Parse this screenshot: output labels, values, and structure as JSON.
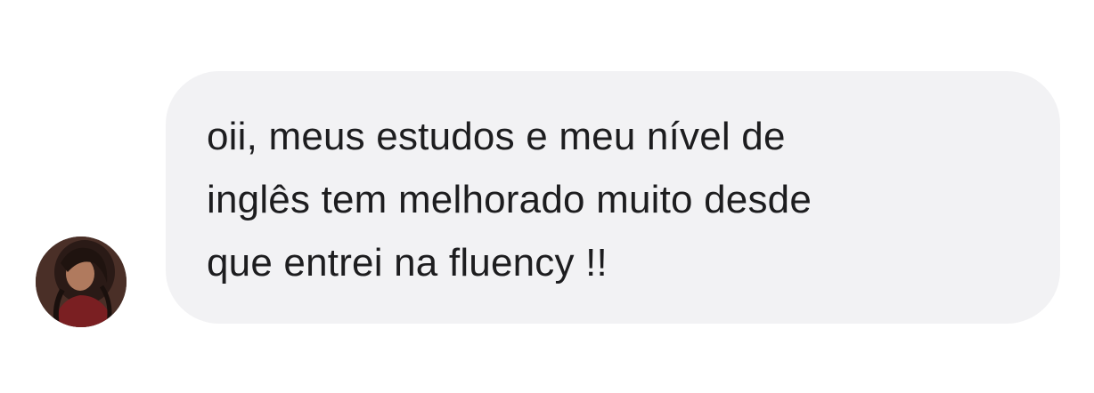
{
  "conversation": {
    "message": {
      "lines": [
        "oii, meus estudos e meu nível de",
        "inglês tem melhorado muito desde",
        "que entrei na fluency !!"
      ],
      "bubble_color": "#f2f2f4",
      "text_color": "#1d1d1f"
    },
    "sender": {
      "avatar_icon": "profile-photo"
    }
  }
}
